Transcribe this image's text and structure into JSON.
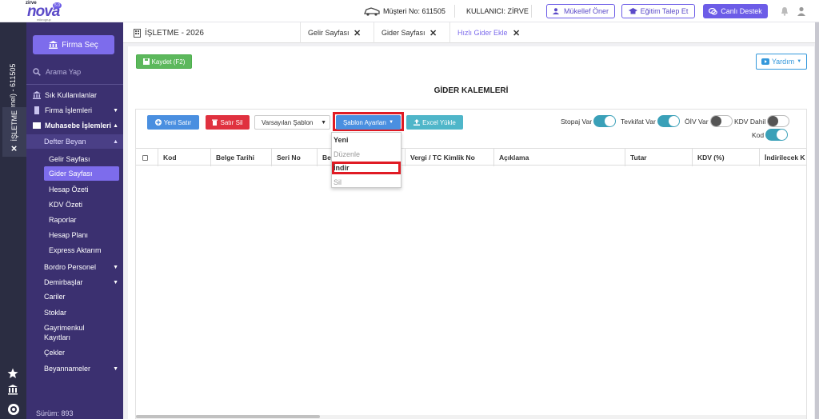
{
  "header": {
    "logo_top": "zirve",
    "logo_main": "nova",
    "logo_version": "5.0",
    "logo_sub": "mikrogrup",
    "customer_no": "Müşteri No: 611505",
    "user": "KULLANICI: ZİRVE",
    "btn_recommend": "Mükellef Öner",
    "btn_training": "Eğitim Talep Et",
    "btn_support": "Canlı Destek"
  },
  "strip": {
    "company": "(Genel) - 611505",
    "tab": "İŞLETME"
  },
  "sidebar": {
    "firma_select": "Firma Seç",
    "search_placeholder": "Arama Yap",
    "items": {
      "sik": "Sık Kullanılanlar",
      "firma": "Firma İşlemleri",
      "muhasebe": "Muhasebe İşlemleri",
      "defter": "Defter Beyan",
      "gelir": "Gelir Sayfası",
      "gider": "Gider Sayfası",
      "hesap": "Hesap Özeti",
      "kdv": "KDV Özeti",
      "raporlar": "Raporlar",
      "plan": "Hesap Planı",
      "express": "Express Aktarım",
      "bordro": "Bordro Personel",
      "demirbas": "Demirbaşlar",
      "cariler": "Cariler",
      "stoklar": "Stoklar",
      "gayri1": "Gayrimenkul",
      "gayri2": "Kayıtları",
      "cekler": "Çekler",
      "beyanname": "Beyannameler"
    },
    "version": "Sürüm: 893"
  },
  "tabs": {
    "page_title": "İŞLETME - 2026",
    "t1": "Gelir Sayfası",
    "t2": "Gider Sayfası",
    "t3": "Hızlı Gider Ekle"
  },
  "content": {
    "save": "Kaydet (F2)",
    "help": "Yardım",
    "title": "GİDER KALEMLERİ",
    "new_row": "Yeni Satır",
    "delete_row": "Satır Sil",
    "template_select": "Varsayılan Şablon",
    "template_settings": "Şablon Ayarları",
    "excel": "Excel Yükle",
    "toggles": {
      "stopaj": "Stopaj Var",
      "tevkifat": "Tevkifat Var",
      "oiv": "ÖİV Var",
      "kdv_dahil": "KDV Dahil",
      "kod": "Kod"
    },
    "columns": {
      "kod": "Kod",
      "belge": "Belge Tarihi",
      "seri": "Seri No",
      "be": "Be",
      "vergi": "Vergi / TC Kimlik No",
      "aciklama": "Açıklama",
      "tutar": "Tutar",
      "kdv": "KDV (%)",
      "indirilecek": "İndirilecek K"
    },
    "dropdown": {
      "yeni": "Yeni",
      "duzenle": "Düzenle",
      "indir": "İndir",
      "sil": "Sil"
    }
  }
}
